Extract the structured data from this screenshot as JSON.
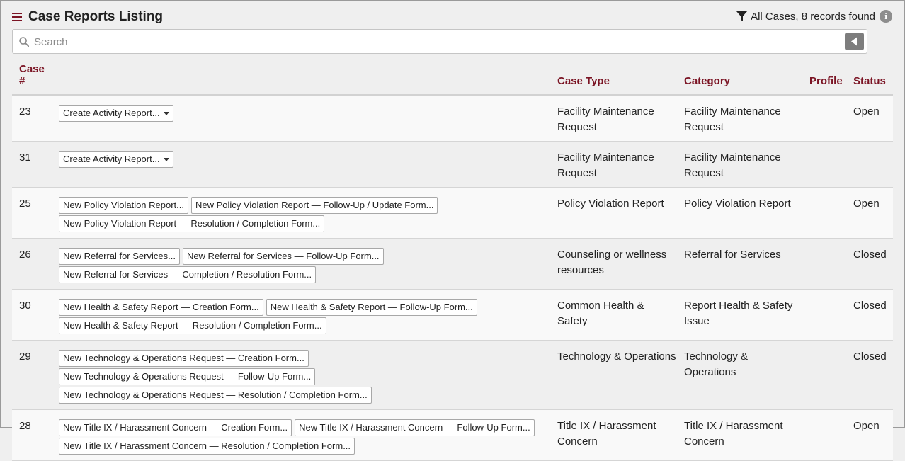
{
  "header": {
    "title": "Case Reports Listing",
    "filter_text": "All Cases, 8 records found"
  },
  "search": {
    "placeholder": "Search"
  },
  "table": {
    "columns": {
      "case_num_line1": "Case",
      "case_num_line2": "#",
      "case_type": "Case Type",
      "category": "Category",
      "profile": "Profile",
      "status": "Status"
    },
    "rows": [
      {
        "case": "23",
        "actions": [
          {
            "label": "Create Activity Report...",
            "dropdown": true
          }
        ],
        "case_type": "Facility Maintenance Request",
        "category": "Facility Maintenance Request",
        "profile": "",
        "status": "Open"
      },
      {
        "case": "31",
        "actions": [
          {
            "label": "Create Activity Report...",
            "dropdown": true
          }
        ],
        "case_type": "Facility Maintenance Request",
        "category": "Facility Maintenance Request",
        "profile": "",
        "status": ""
      },
      {
        "case": "25",
        "actions": [
          {
            "label": "New Policy Violation Report..."
          },
          {
            "label": "New Policy Violation Report — Follow-Up / Update Form..."
          },
          {
            "label": "New Policy Violation Report — Resolution / Completion Form..."
          }
        ],
        "case_type": "Policy Violation Report",
        "category": "Policy Violation Report",
        "profile": "",
        "status": "Open"
      },
      {
        "case": "26",
        "actions": [
          {
            "label": "New Referral for Services..."
          },
          {
            "label": "New Referral for Services — Follow-Up Form..."
          },
          {
            "label": "New Referral for Services — Completion / Resolution Form..."
          }
        ],
        "case_type": "Counseling or wellness resources",
        "category": "Referral for Services",
        "profile": "",
        "status": "Closed"
      },
      {
        "case": "30",
        "actions": [
          {
            "label": "New Health & Safety Report — Creation Form..."
          },
          {
            "label": "New Health & Safety Report — Follow-Up Form..."
          },
          {
            "label": "New Health & Safety Report — Resolution / Completion Form..."
          }
        ],
        "case_type": "Common Health & Safety",
        "category": "Report Health & Safety Issue",
        "profile": "",
        "status": "Closed"
      },
      {
        "case": "29",
        "actions": [
          {
            "label": "New Technology & Operations Request — Creation Form..."
          },
          {
            "label": "New Technology & Operations Request — Follow-Up Form..."
          },
          {
            "label": "New Technology & Operations Request — Resolution / Completion Form..."
          }
        ],
        "case_type": "Technology & Operations",
        "category": "Technology & Operations",
        "profile": "",
        "status": "Closed"
      },
      {
        "case": "28",
        "actions": [
          {
            "label": "New Title IX / Harassment Concern — Creation Form..."
          },
          {
            "label": "New Title IX / Harassment Concern — Follow-Up Form..."
          },
          {
            "label": "New Title IX / Harassment Concern — Resolution / Completion Form..."
          }
        ],
        "case_type": "Title IX / Harassment Concern",
        "category": "Title IX / Harassment Concern",
        "profile": "",
        "status": "Open"
      }
    ]
  },
  "icons": {
    "menu": "hamburger-menu-icon",
    "filter": "funnel-filter-icon",
    "info": "info-circle-icon",
    "search": "magnifier-search-icon",
    "collapse": "triangle-left-icon"
  },
  "colors": {
    "accent": "#7b1424",
    "background": "#efefef",
    "button_gray": "#7d7d7d"
  }
}
